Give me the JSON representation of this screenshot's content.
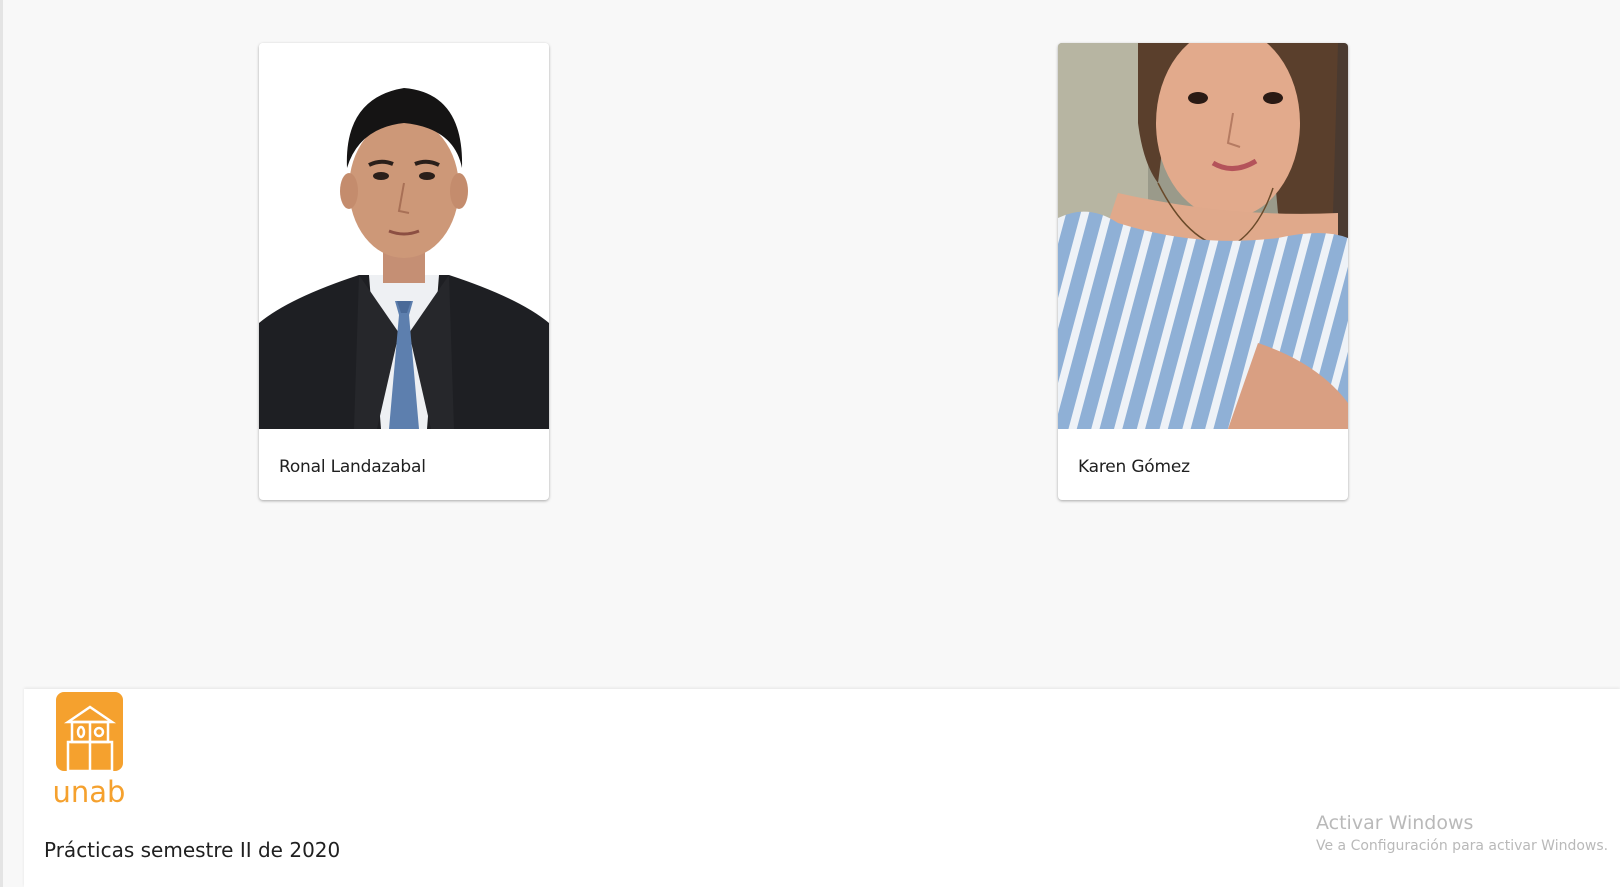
{
  "cards": [
    {
      "name": "Ronal Landazabal",
      "photo": "portrait-man-suit"
    },
    {
      "name": "Karen Gómez",
      "photo": "portrait-woman-striped-top"
    }
  ],
  "footer": {
    "logo_text": "unab",
    "caption": "Prácticas semestre II de 2020"
  },
  "watermark": {
    "title": "Activar Windows",
    "subtitle": "Ve a Configuración para activar Windows."
  },
  "colors": {
    "brand_orange": "#f5a12e",
    "background": "#f8f8f8",
    "card": "#ffffff"
  }
}
